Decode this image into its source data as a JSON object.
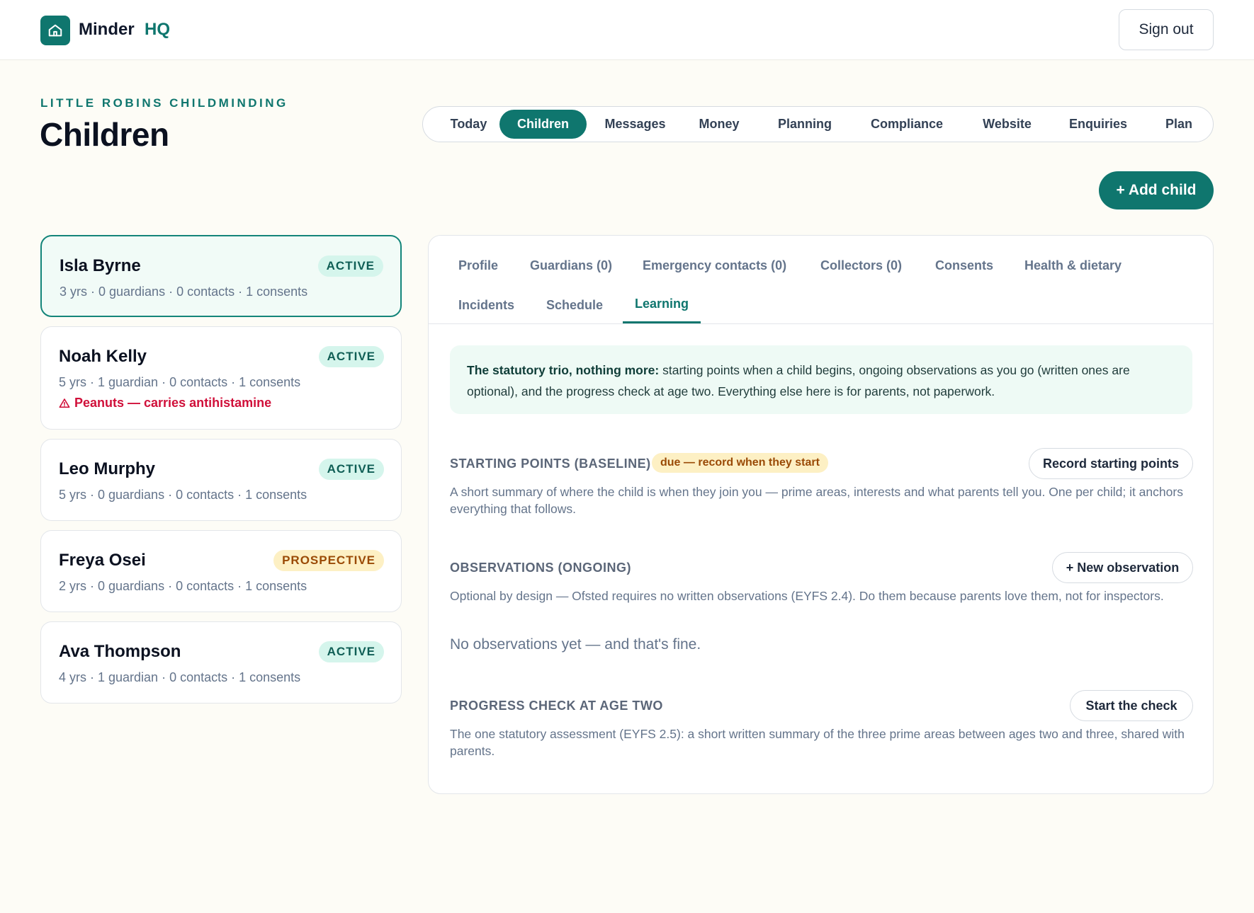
{
  "app": {
    "logo_name": "Minder",
    "logo_suffix": "HQ",
    "sign_out_label": "Sign out"
  },
  "header": {
    "eyebrow": "LITTLE ROBINS CHILDMINDING",
    "title": "Children",
    "add_child_label": "+ Add child"
  },
  "nav": {
    "items": [
      "Today",
      "Children",
      "Messages",
      "Money",
      "Planning",
      "Compliance",
      "Website",
      "Enquiries",
      "Plan"
    ],
    "active": "Children"
  },
  "children": [
    {
      "name": "Isla Byrne",
      "status": "ACTIVE",
      "meta": "3 yrs · 0 guardians · 0 contacts · 1 consents",
      "alert": "",
      "selected": true
    },
    {
      "name": "Noah Kelly",
      "status": "ACTIVE",
      "meta": "5 yrs · 1 guardian · 0 contacts · 1 consents",
      "alert": "Peanuts — carries antihistamine",
      "selected": false
    },
    {
      "name": "Leo Murphy",
      "status": "ACTIVE",
      "meta": "5 yrs · 0 guardians · 0 contacts · 1 consents",
      "alert": "",
      "selected": false
    },
    {
      "name": "Freya Osei",
      "status": "PROSPECTIVE",
      "meta": "2 yrs · 0 guardians · 0 contacts · 1 consents",
      "alert": "",
      "selected": false
    },
    {
      "name": "Ava Thompson",
      "status": "ACTIVE",
      "meta": "4 yrs · 1 guardian · 0 contacts · 1 consents",
      "alert": "",
      "selected": false
    }
  ],
  "detail_tabs": {
    "items": [
      "Profile",
      "Guardians (0)",
      "Emergency contacts (0)",
      "Collectors (0)",
      "Consents",
      "Health & dietary",
      "Incidents",
      "Schedule",
      "Learning"
    ],
    "active": "Learning"
  },
  "learning": {
    "note_lead": "The statutory trio, nothing more:",
    "note_body": " starting points when a child begins, ongoing observations as you go (written ones are optional), and the progress check at age two. Everything else here is for parents, not paperwork.",
    "baseline": {
      "title": "STARTING POINTS (BASELINE)",
      "badge": "due — record when they start",
      "button": "Record starting points",
      "description": "A short summary of where the child is when they join you — prime areas, interests and what parents tell you. One per child; it anchors everything that follows."
    },
    "observations": {
      "title": "OBSERVATIONS (ONGOING)",
      "button": "+ New observation",
      "description": "Optional by design — Ofsted requires no written observations (EYFS 2.4). Do them because parents love them, not for inspectors.",
      "empty": "No observations yet — and that's fine."
    },
    "progress_check": {
      "title": "PROGRESS CHECK AT AGE TWO",
      "button": "Start the check",
      "description": "The one statutory assessment (EYFS 2.5): a short written summary of the three prime areas between ages two and three, shared with parents."
    }
  },
  "colors": {
    "brand": "#0f766e",
    "background": "#fdfcf6",
    "alert": "#d0103a",
    "prospective": "#9a4a06"
  },
  "icons": {
    "logo": "home-icon",
    "alert": "warning-triangle-icon"
  }
}
